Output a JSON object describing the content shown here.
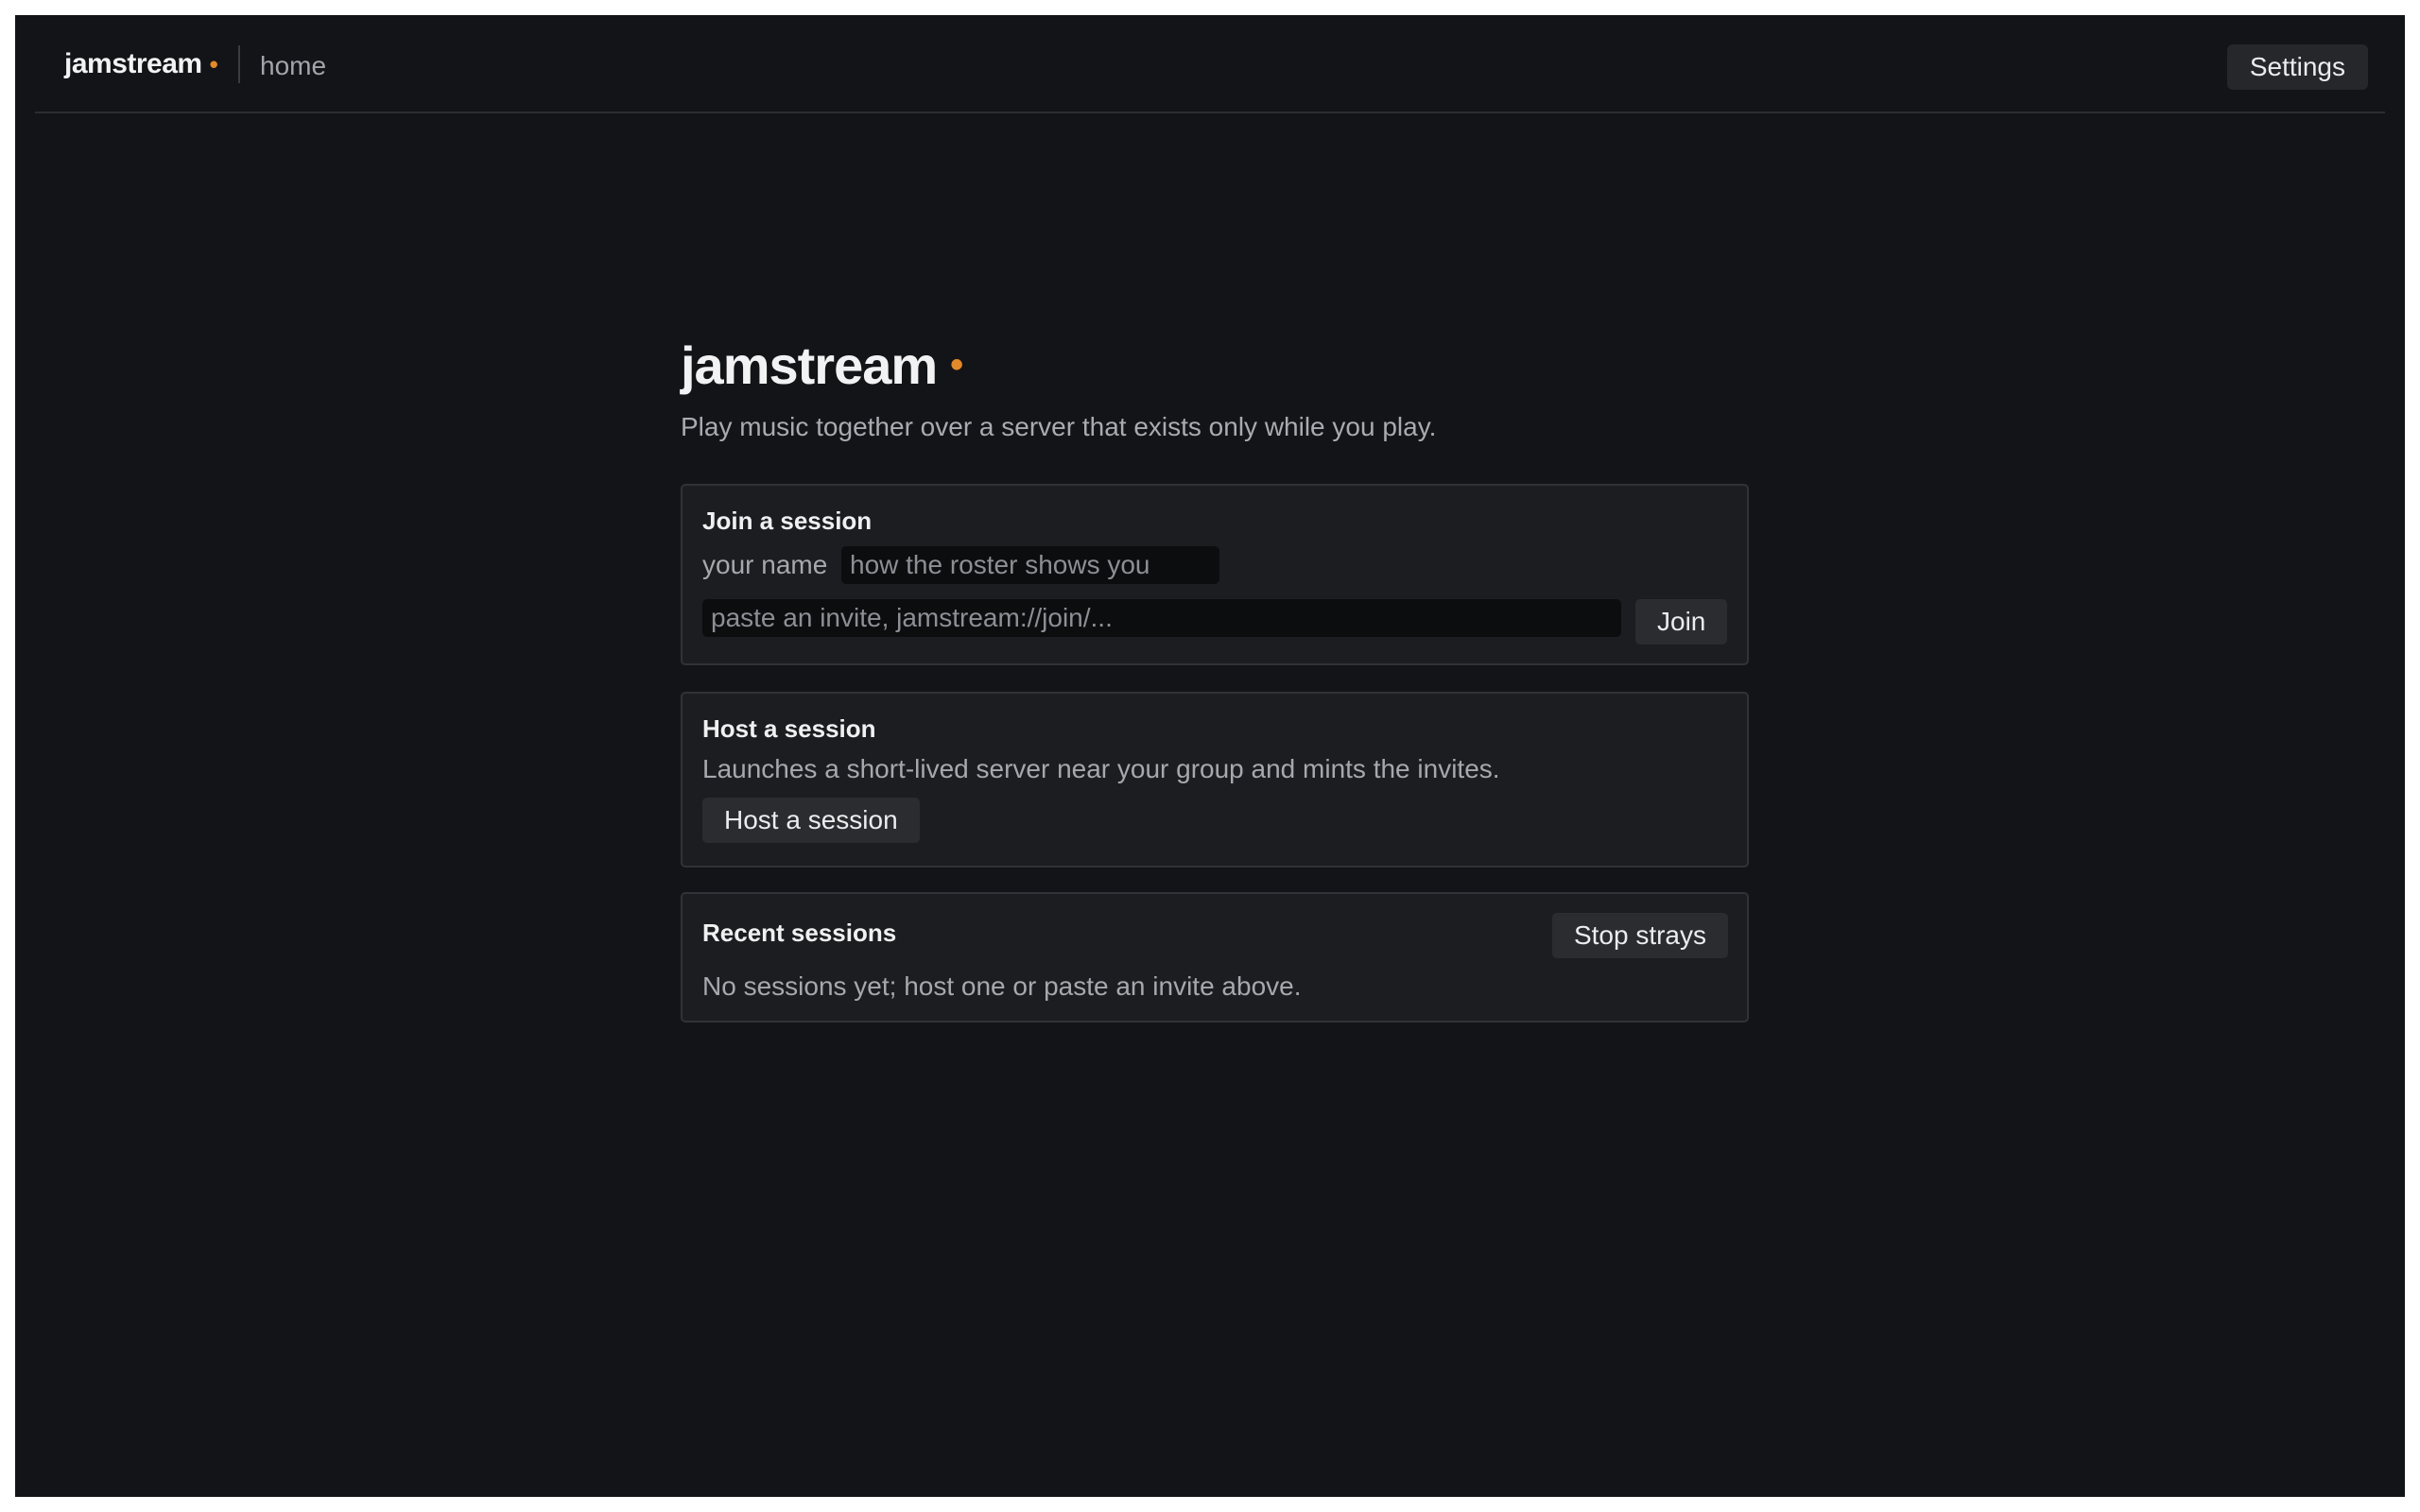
{
  "app": {
    "name": "jamstream",
    "accent_color": "#e48a2a",
    "background_color": "#131417"
  },
  "topbar": {
    "brand": "jamstream",
    "brand_dot": "•",
    "breadcrumb": "home",
    "settings_label": "Settings"
  },
  "hero": {
    "title": "jamstream",
    "dot": "•",
    "tagline": "Play music together over a server that exists only while you play."
  },
  "join_card": {
    "title": "Join a session",
    "name_label": "your name",
    "name_placeholder": "how the roster shows you",
    "name_value": "",
    "invite_placeholder": "paste an invite, jamstream://join/...",
    "invite_value": "",
    "join_label": "Join"
  },
  "host_card": {
    "title": "Host a session",
    "description": "Launches a short-lived server near your group and mints the invites.",
    "host_label": "Host a session"
  },
  "recent_card": {
    "title": "Recent sessions",
    "stop_label": "Stop strays",
    "empty_text": "No sessions yet; host one or paste an invite above."
  }
}
